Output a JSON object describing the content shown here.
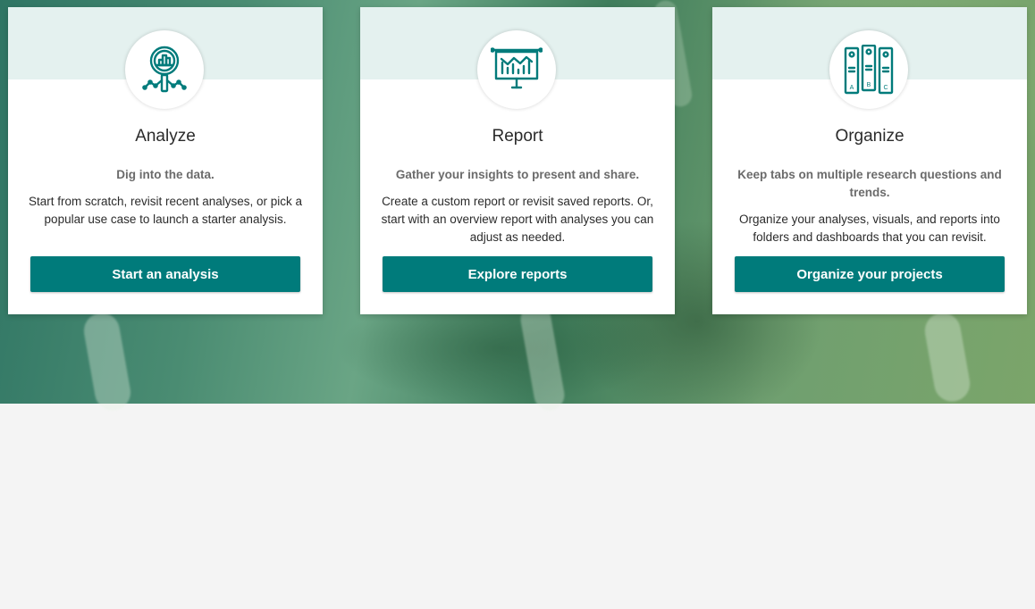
{
  "cards": [
    {
      "icon": "magnifier-chart-icon",
      "title": "Analyze",
      "tagline": "Dig into the data.",
      "description": "Start from scratch, revisit recent analyses, or pick a popular use case to launch a starter analysis.",
      "button": "Start an analysis"
    },
    {
      "icon": "presentation-board-icon",
      "title": "Report",
      "tagline": "Gather your insights to present and share.",
      "description": "Create a custom report or revisit saved reports. Or, start with an overview report with analyses you can adjust as needed.",
      "button": "Explore reports"
    },
    {
      "icon": "binders-icon",
      "title": "Organize",
      "tagline": "Keep tabs on multiple research questions and trends.",
      "description": "Organize your analyses, visuals, and reports into folders and dashboards that you can revisit.",
      "button": "Organize your projects"
    }
  ],
  "colors": {
    "accent": "#007b7b",
    "band": "#e4f1ef",
    "page_background": "#f4f4f4"
  },
  "binder_letters": [
    "A",
    "B",
    "C"
  ]
}
